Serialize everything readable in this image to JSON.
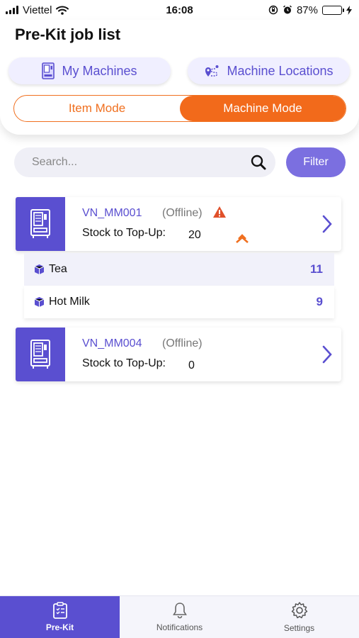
{
  "status_bar": {
    "carrier": "Viettel",
    "time": "16:08",
    "battery_percent": "87%",
    "battery_level": 0.87
  },
  "header": {
    "title": "Pre-Kit job list",
    "my_machines_label": "My Machines",
    "machine_locations_label": "Machine Locations",
    "mode_item_label": "Item Mode",
    "mode_machine_label": "Machine Mode",
    "active_mode": "Machine Mode"
  },
  "search": {
    "placeholder": "Search...",
    "value": "",
    "filter_label": "Filter"
  },
  "machines": [
    {
      "id": "VN_MM001",
      "status": "(Offline)",
      "stock_label": "Stock to Top-Up:",
      "stock_value": "20",
      "has_alert": true,
      "expanded": true,
      "items": [
        {
          "name": "Tea",
          "qty": "11"
        },
        {
          "name": "Hot Milk",
          "qty": "9"
        }
      ]
    },
    {
      "id": "VN_MM004",
      "status": "(Offline)",
      "stock_label": "Stock to Top-Up:",
      "stock_value": "0",
      "has_alert": false,
      "expanded": false,
      "items": []
    }
  ],
  "bottom_nav": {
    "items": [
      {
        "label": "Pre-Kit",
        "icon": "clipboard-icon",
        "active": true
      },
      {
        "label": "Notifications",
        "icon": "bell-icon",
        "active": false
      },
      {
        "label": "Settings",
        "icon": "gear-icon",
        "active": false
      }
    ]
  },
  "colors": {
    "primary": "#5a4fd0",
    "accent": "#f26a1b",
    "alert": "#e0502a",
    "battery": "#3cc04a"
  }
}
